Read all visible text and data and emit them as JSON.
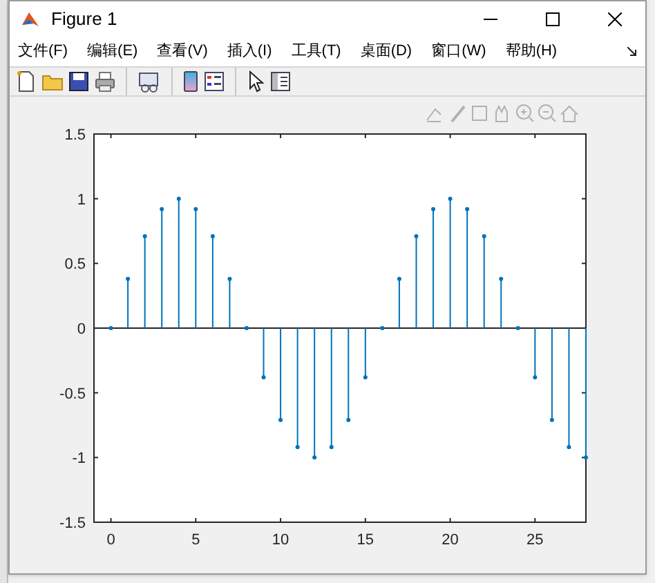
{
  "window": {
    "title": "Figure 1"
  },
  "menu": [
    "文件(F)",
    "编辑(E)",
    "查看(V)",
    "插入(I)",
    "工具(T)",
    "桌面(D)",
    "窗口(W)",
    "帮助(H)"
  ],
  "toolbar": [
    {
      "kind": "new"
    },
    {
      "kind": "open"
    },
    {
      "kind": "save"
    },
    {
      "kind": "print"
    },
    {
      "kind": "sep"
    },
    {
      "kind": "link"
    },
    {
      "kind": "sep"
    },
    {
      "kind": "colorbar"
    },
    {
      "kind": "legend"
    },
    {
      "kind": "sep"
    },
    {
      "kind": "pointer"
    },
    {
      "kind": "inspector"
    }
  ],
  "chart_data": {
    "type": "scatter",
    "xlim": [
      -1,
      28
    ],
    "ylim": [
      -1.5,
      1.5
    ],
    "xticks": [
      0,
      5,
      10,
      15,
      20,
      25
    ],
    "yticks": [
      {
        "value": -1.5,
        "label": "-1.5"
      },
      {
        "value": -1,
        "label": "-1"
      },
      {
        "value": -0.5,
        "label": "-0.5"
      },
      {
        "value": 0,
        "label": "0"
      },
      {
        "value": 0.5,
        "label": "0.5"
      },
      {
        "value": 1,
        "label": "1"
      },
      {
        "value": 1.5,
        "label": "1.5"
      }
    ],
    "x": [
      0,
      1,
      2,
      3,
      4,
      5,
      6,
      7,
      8,
      9,
      10,
      11,
      12,
      13,
      14,
      15,
      16,
      17,
      18,
      19,
      20,
      21,
      22,
      23,
      24,
      25,
      26,
      27,
      28
    ],
    "series": [
      {
        "color": "#0072bd",
        "values": [
          0,
          0.38,
          0.71,
          0.92,
          1,
          0.92,
          0.71,
          0.38,
          0,
          -0.38,
          -0.71,
          -0.92,
          -1,
          -0.92,
          -0.71,
          -0.38,
          0,
          0.38,
          0.71,
          0.92,
          1,
          0.92,
          0.71,
          0.38,
          0,
          -0.38,
          -0.71,
          -0.92,
          -1
        ]
      }
    ]
  }
}
